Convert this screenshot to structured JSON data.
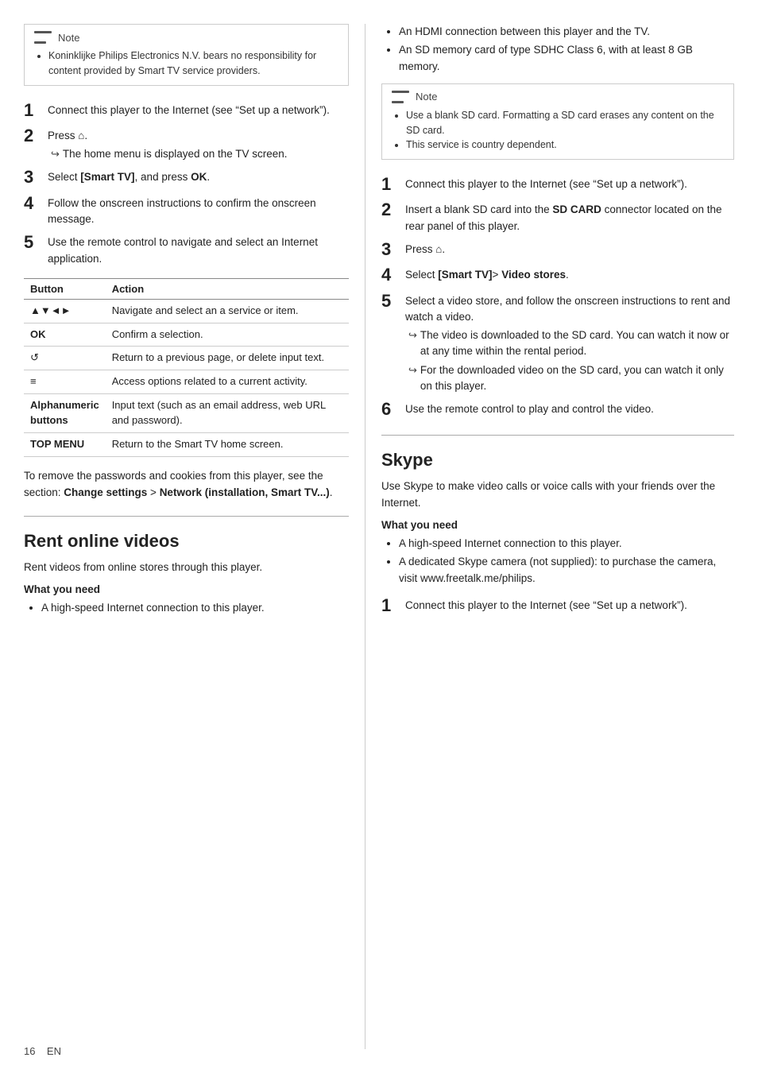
{
  "page_number": "16",
  "lang": "EN",
  "left_col": {
    "note1": {
      "title": "Note",
      "items": [
        "Koninklijke Philips Electronics N.V. bears no responsibility for content provided by Smart TV service providers."
      ]
    },
    "steps1": [
      {
        "num": "1",
        "text": "Connect this player to the Internet (see \"Set up a network\")."
      },
      {
        "num": "2",
        "text": "Press ⌂.",
        "sub": "↪ The home menu is displayed on the TV screen."
      },
      {
        "num": "3",
        "text": "Select [Smart TV], and press OK."
      },
      {
        "num": "4",
        "text": "Follow the onscreen instructions to confirm the onscreen message."
      },
      {
        "num": "5",
        "text": "Use the remote control to navigate and select an Internet application."
      }
    ],
    "table": {
      "headers": [
        "Button",
        "Action"
      ],
      "rows": [
        {
          "button": "▲▼◄►",
          "action": "Navigate and select an a service or item."
        },
        {
          "button": "OK",
          "action": "Confirm a selection."
        },
        {
          "button": "↺",
          "action": "Return to a previous page, or delete input text."
        },
        {
          "button": "≡",
          "action": "Access options related to a current activity."
        },
        {
          "button": "Alphanumeric buttons",
          "action": "Input text (such as an email address, web URL and password)."
        },
        {
          "button": "TOP MENU",
          "action": "Return to the Smart TV home screen."
        }
      ]
    },
    "footer_note": "To remove the passwords and cookies from this player, see the section: Change settings > Network (installation, Smart TV...).",
    "rent_section": {
      "title": "Rent online videos",
      "intro": "Rent videos from online stores through this player.",
      "what_you_need_label": "What you need",
      "bullets": [
        "A high-speed Internet connection to this player."
      ]
    }
  },
  "right_col": {
    "bullets_top": [
      "An HDMI connection between this player and the TV.",
      "An SD memory card of type SDHC Class 6, with at least 8 GB memory."
    ],
    "note2": {
      "title": "Note",
      "items": [
        "Use a blank SD card. Formatting a SD card erases any content on the SD card.",
        "This service is country dependent."
      ]
    },
    "steps2": [
      {
        "num": "1",
        "text": "Connect this player to the Internet (see \"Set up a network\")."
      },
      {
        "num": "2",
        "text": "Insert a blank SD card into the SD CARD connector located on the rear panel of this player.",
        "sd_bold": "SD CARD"
      },
      {
        "num": "3",
        "text": "Press ⌂."
      },
      {
        "num": "4",
        "text": "Select [Smart TV]> Video stores.",
        "smart_bold": "[Smart TV]",
        "video_bold": "Video stores"
      },
      {
        "num": "5",
        "text": "Select a video store, and follow the onscreen instructions to rent and watch a video.",
        "sub1": "↪ The video is downloaded to the SD card. You can watch it now or at any time within the rental period.",
        "sub2": "↪ For the downloaded video on the SD card, you can watch it only on this player."
      },
      {
        "num": "6",
        "text": "Use the remote control to play and control the video."
      }
    ],
    "skype_section": {
      "title": "Skype",
      "intro": "Use Skype to make video calls or voice calls with your friends over the Internet.",
      "what_you_need_label": "What you need",
      "bullets": [
        "A high-speed Internet connection to this player.",
        "A dedicated Skype camera (not supplied): to purchase the camera, visit www.freetalk.me/philips."
      ],
      "steps": [
        {
          "num": "1",
          "text": "Connect this player to the Internet (see \"Set up a network\")."
        }
      ]
    }
  }
}
